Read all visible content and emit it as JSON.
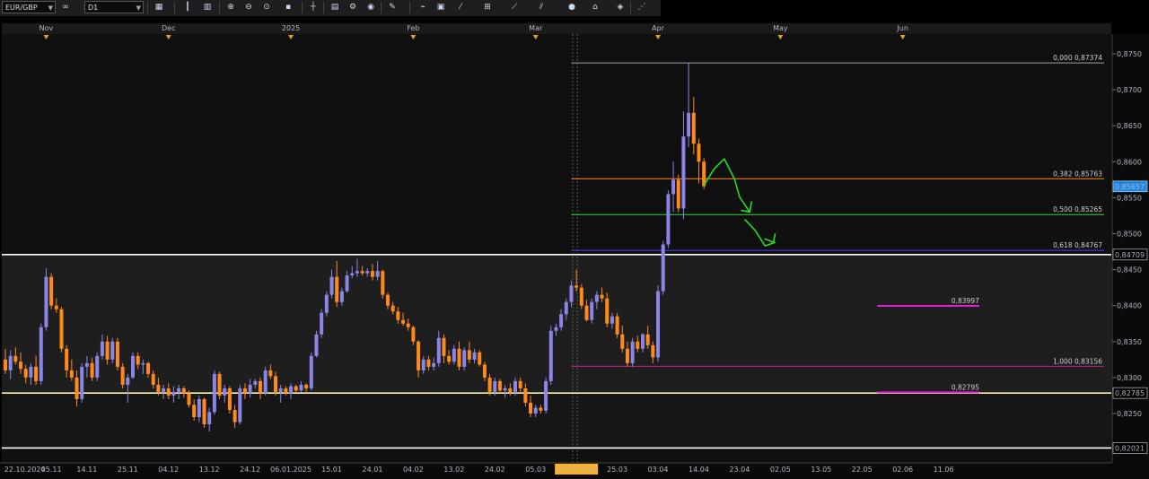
{
  "toolbar": {
    "symbol": "EUR/GBP",
    "timeframe": "D1",
    "buttons": [
      "link-icon",
      "chart-type-icon",
      "bar-chart-icon",
      "candles-icon",
      "zoom-in-icon",
      "zoom-out-icon",
      "zoom-fit-icon",
      "cursor-icon",
      "pointer-icon",
      "crosshair-icon",
      "template-icon",
      "settings-icon",
      "indicators-icon",
      "globe-icon",
      "pen-icon",
      "trendline-icon",
      "text-icon",
      "shapes-icon",
      "fib-icon",
      "channel-icon",
      "arrow-tool-icon",
      "circle-icon",
      "magnet-icon",
      "eraser-icon",
      "more-icon"
    ]
  },
  "colors": {
    "bull": "#8a86e8",
    "bear": "#ff8a1c",
    "price_badge_bg": "#1e88e5",
    "fib_382": "#ff8a1c",
    "fib_500": "#3bd13b",
    "fib_618": "#4b3cff",
    "fib_100": "#c02090",
    "magenta": "#e020d0",
    "yellow_line": "#fff2b0",
    "arrow": "#2ad82a"
  },
  "chart_data": {
    "type": "candlestick",
    "symbol": "EUR/GBP",
    "timeframe": "D1",
    "ylim": [
      0.8205,
      0.876
    ],
    "y_ticks": [
      "0,8750",
      "0,8700",
      "0,8650",
      "0,8600",
      "0,8550",
      "0,8500",
      "0,8450",
      "0,8400",
      "0,8350",
      "0,8300",
      "0,8250"
    ],
    "y_tick_values": [
      0.875,
      0.87,
      0.865,
      0.86,
      0.855,
      0.85,
      0.845,
      0.84,
      0.835,
      0.83,
      0.825
    ],
    "x_date_labels": [
      "22.10.2024",
      "05.11",
      "14.11",
      "25.11",
      "04.12",
      "13.12",
      "24.12",
      "06.01.2025",
      "15.01",
      "24.01",
      "04.02",
      "13.02",
      "24.02",
      "05.03",
      "14.03.2025",
      "25.03",
      "03.04",
      "14.04",
      "23.04",
      "02.05",
      "13.05",
      "22.05",
      "02.06",
      "11.06"
    ],
    "x_date_label_bars": [
      1,
      9,
      16,
      24,
      32,
      40,
      48,
      56,
      64,
      72,
      80,
      88,
      96,
      104,
      112,
      120,
      128,
      136,
      144,
      152,
      160,
      168,
      176,
      184
    ],
    "highlighted_date_label": "14.03.2025",
    "highlighted_bar": 112,
    "months": [
      "Nov",
      "Dec",
      "2025",
      "Feb",
      "Mar",
      "Apr",
      "May",
      "Jun"
    ],
    "month_bars": [
      8,
      32,
      56,
      80,
      104,
      128,
      152,
      176
    ],
    "current_price": "0,85657",
    "current_price_value": 0.85657,
    "fibonacci": {
      "start_bar": 111,
      "end_bar": 191,
      "levels": [
        {
          "label": "0,000 0,87374",
          "price": 0.87374,
          "color": "#a0a0a0"
        },
        {
          "label": "0,382 0,85763",
          "price": 0.85763,
          "color": "#ff8a1c"
        },
        {
          "label": "0,500 0,85265",
          "price": 0.85265,
          "color": "#3bd13b"
        },
        {
          "label": "0,618 0,84767",
          "price": 0.84767,
          "color": "#4b3cff"
        },
        {
          "label": "1,000 0,83156",
          "price": 0.83156,
          "color": "#c02090"
        }
      ]
    },
    "horizontal_lines": [
      {
        "price": 0.84709,
        "label": "0,84709",
        "color": "#ffffff"
      },
      {
        "price": 0.82785,
        "label": "0,82785",
        "color": "#fff2b0"
      },
      {
        "price": 0.82021,
        "label": "0,82021",
        "color": "#ffffff"
      }
    ],
    "segments": [
      {
        "price": 0.83997,
        "label": "0,83997",
        "start_bar": 171,
        "end_bar": 191,
        "color": "#e020d0"
      },
      {
        "price": 0.82795,
        "label": "0,82795",
        "start_bar": 171,
        "end_bar": 191,
        "color": "#e020d0"
      }
    ],
    "candles": [
      [
        0.8325,
        0.834,
        0.8305,
        0.831
      ],
      [
        0.831,
        0.8338,
        0.8298,
        0.833
      ],
      [
        0.833,
        0.8342,
        0.8318,
        0.8322
      ],
      [
        0.8322,
        0.8335,
        0.8305,
        0.8312
      ],
      [
        0.8312,
        0.8318,
        0.8292,
        0.83
      ],
      [
        0.83,
        0.832,
        0.829,
        0.8315
      ],
      [
        0.8315,
        0.833,
        0.829,
        0.8295
      ],
      [
        0.8295,
        0.8375,
        0.829,
        0.837
      ],
      [
        0.837,
        0.8452,
        0.8365,
        0.844
      ],
      [
        0.844,
        0.8445,
        0.8395,
        0.84
      ],
      [
        0.84,
        0.841,
        0.839,
        0.8395
      ],
      [
        0.8395,
        0.8398,
        0.8335,
        0.834
      ],
      [
        0.834,
        0.8345,
        0.83,
        0.831
      ],
      [
        0.831,
        0.8325,
        0.8295,
        0.83
      ],
      [
        0.83,
        0.831,
        0.826,
        0.827
      ],
      [
        0.827,
        0.832,
        0.8265,
        0.8315
      ],
      [
        0.8315,
        0.833,
        0.83,
        0.832
      ],
      [
        0.832,
        0.8328,
        0.8295,
        0.83
      ],
      [
        0.83,
        0.8335,
        0.8295,
        0.833
      ],
      [
        0.833,
        0.836,
        0.8325,
        0.835
      ],
      [
        0.835,
        0.8358,
        0.8318,
        0.8325
      ],
      [
        0.8325,
        0.8355,
        0.832,
        0.835
      ],
      [
        0.835,
        0.8355,
        0.831,
        0.8315
      ],
      [
        0.8315,
        0.832,
        0.8285,
        0.829
      ],
      [
        0.829,
        0.8305,
        0.8265,
        0.83
      ],
      [
        0.83,
        0.8335,
        0.8298,
        0.833
      ],
      [
        0.833,
        0.8335,
        0.8312,
        0.8318
      ],
      [
        0.8318,
        0.8325,
        0.8305,
        0.832
      ],
      [
        0.832,
        0.8322,
        0.83,
        0.8305
      ],
      [
        0.8305,
        0.831,
        0.8285,
        0.829
      ],
      [
        0.829,
        0.83,
        0.8275,
        0.828
      ],
      [
        0.828,
        0.829,
        0.827,
        0.8285
      ],
      [
        0.8285,
        0.8292,
        0.827,
        0.8275
      ],
      [
        0.8275,
        0.8288,
        0.8265,
        0.828
      ],
      [
        0.828,
        0.829,
        0.827,
        0.8285
      ],
      [
        0.8285,
        0.8288,
        0.8272,
        0.8278
      ],
      [
        0.8278,
        0.8282,
        0.8258,
        0.8262
      ],
      [
        0.8262,
        0.827,
        0.824,
        0.8245
      ],
      [
        0.8245,
        0.8275,
        0.8238,
        0.827
      ],
      [
        0.827,
        0.8272,
        0.823,
        0.8235
      ],
      [
        0.8235,
        0.8258,
        0.8225,
        0.8252
      ],
      [
        0.8252,
        0.831,
        0.8248,
        0.8305
      ],
      [
        0.8305,
        0.8308,
        0.827,
        0.8275
      ],
      [
        0.8275,
        0.829,
        0.8265,
        0.8285
      ],
      [
        0.8285,
        0.8288,
        0.825,
        0.8255
      ],
      [
        0.8255,
        0.8262,
        0.823,
        0.8238
      ],
      [
        0.8238,
        0.829,
        0.8235,
        0.8285
      ],
      [
        0.8285,
        0.8292,
        0.827,
        0.8278
      ],
      [
        0.8278,
        0.8298,
        0.8272,
        0.829
      ],
      [
        0.829,
        0.8298,
        0.8285,
        0.8295
      ],
      [
        0.8295,
        0.83,
        0.827,
        0.8278
      ],
      [
        0.8278,
        0.8315,
        0.8275,
        0.831
      ],
      [
        0.831,
        0.8318,
        0.8298,
        0.8302
      ],
      [
        0.8302,
        0.8308,
        0.8275,
        0.828
      ],
      [
        0.828,
        0.829,
        0.8265,
        0.8285
      ],
      [
        0.8285,
        0.8288,
        0.8275,
        0.8278
      ],
      [
        0.8278,
        0.8292,
        0.827,
        0.8288
      ],
      [
        0.8288,
        0.829,
        0.8278,
        0.8282
      ],
      [
        0.8282,
        0.8295,
        0.828,
        0.829
      ],
      [
        0.829,
        0.8292,
        0.828,
        0.8285
      ],
      [
        0.8285,
        0.8335,
        0.8282,
        0.833
      ],
      [
        0.833,
        0.8365,
        0.8328,
        0.836
      ],
      [
        0.836,
        0.8395,
        0.8355,
        0.839
      ],
      [
        0.839,
        0.842,
        0.8385,
        0.8415
      ],
      [
        0.8415,
        0.845,
        0.841,
        0.844
      ],
      [
        0.844,
        0.8462,
        0.8398,
        0.8405
      ],
      [
        0.8405,
        0.8425,
        0.84,
        0.842
      ],
      [
        0.842,
        0.8448,
        0.8418,
        0.8442
      ],
      [
        0.8442,
        0.8455,
        0.8438,
        0.8445
      ],
      [
        0.8445,
        0.8465,
        0.844,
        0.8448
      ],
      [
        0.8448,
        0.8455,
        0.8442,
        0.8445
      ],
      [
        0.8445,
        0.8452,
        0.844,
        0.8448
      ],
      [
        0.8448,
        0.8458,
        0.8435,
        0.844
      ],
      [
        0.844,
        0.8462,
        0.8435,
        0.8448
      ],
      [
        0.8448,
        0.845,
        0.841,
        0.8415
      ],
      [
        0.8415,
        0.8418,
        0.8395,
        0.84
      ],
      [
        0.84,
        0.8405,
        0.8388,
        0.8392
      ],
      [
        0.8392,
        0.8398,
        0.8375,
        0.838
      ],
      [
        0.838,
        0.839,
        0.8372,
        0.8375
      ],
      [
        0.8375,
        0.8382,
        0.8365,
        0.837
      ],
      [
        0.837,
        0.8372,
        0.8345,
        0.835
      ],
      [
        0.835,
        0.8352,
        0.83,
        0.831
      ],
      [
        0.831,
        0.833,
        0.8305,
        0.8325
      ],
      [
        0.8325,
        0.833,
        0.831,
        0.8315
      ],
      [
        0.8315,
        0.8328,
        0.831,
        0.832
      ],
      [
        0.832,
        0.8365,
        0.8315,
        0.8355
      ],
      [
        0.8355,
        0.836,
        0.832,
        0.833
      ],
      [
        0.833,
        0.8338,
        0.8318,
        0.8322
      ],
      [
        0.8322,
        0.8345,
        0.8318,
        0.834
      ],
      [
        0.834,
        0.835,
        0.831,
        0.8315
      ],
      [
        0.8315,
        0.8342,
        0.831,
        0.8338
      ],
      [
        0.8338,
        0.835,
        0.832,
        0.8325
      ],
      [
        0.8325,
        0.834,
        0.832,
        0.8335
      ],
      [
        0.8335,
        0.8338,
        0.8315,
        0.8318
      ],
      [
        0.8318,
        0.8322,
        0.8295,
        0.83
      ],
      [
        0.83,
        0.8305,
        0.8275,
        0.828
      ],
      [
        0.828,
        0.83,
        0.8275,
        0.8295
      ],
      [
        0.8295,
        0.8298,
        0.8278,
        0.8282
      ],
      [
        0.8282,
        0.829,
        0.8272,
        0.8285
      ],
      [
        0.8285,
        0.8292,
        0.8275,
        0.828
      ],
      [
        0.828,
        0.83,
        0.8275,
        0.8295
      ],
      [
        0.8295,
        0.83,
        0.8278,
        0.8285
      ],
      [
        0.8285,
        0.8292,
        0.826,
        0.8265
      ],
      [
        0.8265,
        0.8275,
        0.8245,
        0.825
      ],
      [
        0.825,
        0.8262,
        0.8245,
        0.8258
      ],
      [
        0.8258,
        0.8262,
        0.825,
        0.8254
      ],
      [
        0.8254,
        0.83,
        0.825,
        0.8295
      ],
      [
        0.8295,
        0.8372,
        0.829,
        0.8365
      ],
      [
        0.8365,
        0.8375,
        0.8358,
        0.837
      ],
      [
        0.837,
        0.8395,
        0.8365,
        0.8388
      ],
      [
        0.8388,
        0.841,
        0.838,
        0.8405
      ],
      [
        0.8405,
        0.8435,
        0.8398,
        0.8428
      ],
      [
        0.8428,
        0.845,
        0.842,
        0.8425
      ],
      [
        0.8425,
        0.843,
        0.8395,
        0.84
      ],
      [
        0.84,
        0.8408,
        0.8378,
        0.838
      ],
      [
        0.838,
        0.841,
        0.8375,
        0.8405
      ],
      [
        0.8405,
        0.842,
        0.8395,
        0.8415
      ],
      [
        0.8415,
        0.8425,
        0.8405,
        0.841
      ],
      [
        0.841,
        0.8418,
        0.837,
        0.8375
      ],
      [
        0.8375,
        0.839,
        0.8368,
        0.8385
      ],
      [
        0.8385,
        0.839,
        0.8355,
        0.836
      ],
      [
        0.836,
        0.8372,
        0.8335,
        0.834
      ],
      [
        0.834,
        0.835,
        0.8315,
        0.832
      ],
      [
        0.832,
        0.8355,
        0.8315,
        0.835
      ],
      [
        0.835,
        0.8358,
        0.8335,
        0.834
      ],
      [
        0.834,
        0.8362,
        0.8335,
        0.836
      ],
      [
        0.836,
        0.8372,
        0.834,
        0.8345
      ],
      [
        0.8345,
        0.835,
        0.832,
        0.8328
      ],
      [
        0.8328,
        0.8428,
        0.8322,
        0.842
      ],
      [
        0.842,
        0.849,
        0.8415,
        0.8485
      ],
      [
        0.8485,
        0.856,
        0.848,
        0.8555
      ],
      [
        0.8555,
        0.86,
        0.853,
        0.8575
      ],
      [
        0.8575,
        0.8582,
        0.853,
        0.8535
      ],
      [
        0.8535,
        0.867,
        0.852,
        0.8635
      ],
      [
        0.8635,
        0.8737,
        0.862,
        0.8668
      ],
      [
        0.8668,
        0.869,
        0.861,
        0.8625
      ],
      [
        0.8625,
        0.8632,
        0.857,
        0.86
      ],
      [
        0.86,
        0.8605,
        0.8562,
        0.8566
      ]
    ],
    "green_arrow_path_bars": [
      [
        137,
        0.8567
      ],
      [
        139,
        0.859
      ],
      [
        141,
        0.8604
      ],
      [
        143,
        0.8576
      ],
      [
        144,
        0.8551
      ],
      [
        146,
        0.853
      ]
    ],
    "green_arrow2_path_bars": [
      [
        145,
        0.852
      ],
      [
        147,
        0.8505
      ],
      [
        149,
        0.8483
      ],
      [
        151,
        0.8488
      ]
    ]
  }
}
